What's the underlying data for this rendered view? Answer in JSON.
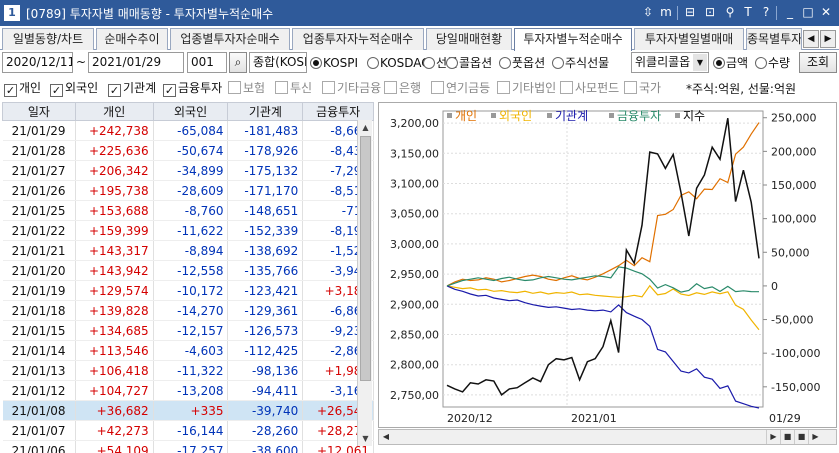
{
  "window": {
    "number": "1",
    "title": "[0789] 투자자별 매매동향 - 투자자별누적순매수",
    "icons": [
      "dock-icon",
      "memo-icon",
      "layout-icon",
      "link-icon",
      "pin-icon",
      "font-size-icon",
      "help-icon",
      "minimize-icon",
      "maximize-icon",
      "close-icon"
    ],
    "icon_glyphs": [
      "⇳",
      "m",
      "⊟",
      "⊡",
      "⚲",
      "T",
      "?",
      "_",
      "□",
      "✕"
    ],
    "title_bg": "#2f5a9a"
  },
  "tabs": [
    {
      "label": "일별동향/차트",
      "active": false
    },
    {
      "label": "순매수추이",
      "active": false
    },
    {
      "label": "업종별투자자순매수",
      "active": false
    },
    {
      "label": "업종투자자누적순매수",
      "active": false
    },
    {
      "label": "당일매매현황",
      "active": false
    },
    {
      "label": "투자자별누적순매수",
      "active": true
    },
    {
      "label": "투자자별일별매매",
      "active": false
    },
    {
      "label": "종목별투자",
      "active": false
    }
  ],
  "controls": {
    "start_date": "2020/12/11",
    "range_sep": "~",
    "end_date": "2021/01/29",
    "code": "001",
    "search_icon": "search-icon",
    "index_name": "종합(KOSP",
    "markets": [
      {
        "label": "KOSPI",
        "selected": true
      },
      {
        "label": "KOSDAQ",
        "selected": false
      },
      {
        "label": "선물",
        "selected": false
      },
      {
        "label": "콜옵션",
        "selected": false
      },
      {
        "label": "풋옵션",
        "selected": false
      },
      {
        "label": "주식선물",
        "selected": false
      }
    ],
    "weekly_select": "위클리콜옵",
    "value_modes": [
      {
        "label": "금액",
        "selected": true
      },
      {
        "label": "수량",
        "selected": false
      }
    ],
    "query_button": "조회"
  },
  "investor_filters": [
    {
      "label": "개인",
      "checked": true
    },
    {
      "label": "외국인",
      "checked": true
    },
    {
      "label": "기관계",
      "checked": true
    },
    {
      "label": "금융투자",
      "checked": true
    },
    {
      "label": "보험",
      "checked": false
    },
    {
      "label": "투신",
      "checked": false
    },
    {
      "label": "기타금융",
      "checked": false
    },
    {
      "label": "은행",
      "checked": false
    },
    {
      "label": "연기금등",
      "checked": false
    },
    {
      "label": "기타법인",
      "checked": false
    },
    {
      "label": "사모펀드",
      "checked": false
    },
    {
      "label": "국가",
      "checked": false
    }
  ],
  "unit_note": "*주식:억원, 선물:억원",
  "table": {
    "headers": [
      "일자",
      "개인",
      "외국인",
      "기관계",
      "금융투자"
    ],
    "selected_row": 14,
    "rows": [
      [
        "21/01/29",
        "+242,738",
        "-65,084",
        "-181,483",
        "-8,661"
      ],
      [
        "21/01/28",
        "+225,636",
        "-50,674",
        "-178,926",
        "-8,436"
      ],
      [
        "21/01/27",
        "+206,342",
        "-34,899",
        "-175,132",
        "-7,297"
      ],
      [
        "21/01/26",
        "+195,738",
        "-28,609",
        "-171,170",
        "-8,518"
      ],
      [
        "21/01/25",
        "+153,688",
        "-8,760",
        "-148,651",
        "-715"
      ],
      [
        "21/01/22",
        "+159,399",
        "-11,622",
        "-152,339",
        "-8,195"
      ],
      [
        "21/01/21",
        "+143,317",
        "-8,894",
        "-138,692",
        "-1,521"
      ],
      [
        "21/01/20",
        "+143,942",
        "-12,558",
        "-135,766",
        "-3,946"
      ],
      [
        "21/01/19",
        "+129,574",
        "-10,172",
        "-123,421",
        "+3,187"
      ],
      [
        "21/01/18",
        "+139,828",
        "-14,270",
        "-129,361",
        "-6,869"
      ],
      [
        "21/01/15",
        "+134,685",
        "-12,157",
        "-126,573",
        "-9,236"
      ],
      [
        "21/01/14",
        "+113,546",
        "-4,603",
        "-112,425",
        "-2,867"
      ],
      [
        "21/01/13",
        "+106,418",
        "-11,322",
        "-98,136",
        "+1,980"
      ],
      [
        "21/01/12",
        "+104,727",
        "-13,208",
        "-94,411",
        "-3,161"
      ],
      [
        "21/01/08",
        "+36,682",
        "+335",
        "-39,740",
        "+26,540"
      ],
      [
        "21/01/07",
        "+42,273",
        "-16,144",
        "-28,260",
        "+28,272"
      ],
      [
        "21/01/06",
        "+54,109",
        "-17,257",
        "-38,600",
        "+12,061"
      ]
    ]
  },
  "colors": {
    "positive": "#d40000",
    "negative": "#0033b8",
    "series_individual": "#e07000",
    "series_foreign": "#f0b400",
    "series_institution": "#1a1aaa",
    "series_financial": "#2a8a6a",
    "series_index": "#111111"
  },
  "scrollbar_buttons": [
    "◀",
    "▶",
    "■",
    "■",
    "▶"
  ],
  "chart_data": {
    "type": "line",
    "legend": [
      "개인",
      "외국인",
      "기관계",
      "금융투자",
      "지수"
    ],
    "legend_placement": "top",
    "x_labels": [
      "2020/12",
      "2021/01",
      "01/29"
    ],
    "y_left_ticks": [
      "3,200,00",
      "3,150,00",
      "3,100,00",
      "3,050,00",
      "3,000,00",
      "2,950,00",
      "2,900,00",
      "2,850,00",
      "2,800,00",
      "2,750,00"
    ],
    "y_left_range": [
      2730,
      3220
    ],
    "y_right_ticks": [
      "250,000",
      "200,000",
      "150,000",
      "100,000",
      "50,000",
      "0",
      "-50,000",
      "-100,000",
      "-150,000"
    ],
    "y_right_range": [
      -180000,
      260000
    ],
    "grid": true,
    "series": [
      {
        "name": "개인",
        "axis": "right",
        "values": [
          0,
          6000,
          10000,
          8000,
          9000,
          12000,
          10000,
          6000,
          8000,
          11000,
          14000,
          16000,
          14000,
          10000,
          8000,
          12000,
          15000,
          11000,
          9000,
          13000,
          18000,
          24000,
          30000,
          38000,
          30000,
          42000,
          36000,
          104727,
          106418,
          113546,
          134685,
          139828,
          129574,
          143942,
          143317,
          159399,
          153688,
          195738,
          206342,
          225636,
          242738
        ]
      },
      {
        "name": "외국인",
        "axis": "right",
        "values": [
          0,
          -2000,
          -4000,
          -3000,
          -6000,
          -5000,
          -8000,
          -7000,
          -9000,
          -10000,
          -8000,
          -11000,
          -9000,
          -12000,
          -10000,
          -11000,
          -9000,
          -13000,
          -12000,
          -14000,
          -15000,
          -16000,
          -17000,
          -16000,
          -14000,
          -16144,
          335,
          -13208,
          -11322,
          -4603,
          -12157,
          -14270,
          -10172,
          -12558,
          -8894,
          -11622,
          -8760,
          -28609,
          -34899,
          -50674,
          -65084
        ]
      },
      {
        "name": "기관계",
        "axis": "right",
        "values": [
          0,
          -5000,
          -8000,
          -12000,
          -15000,
          -14000,
          -18000,
          -20000,
          -22000,
          -21000,
          -25000,
          -28000,
          -30000,
          -32000,
          -31000,
          -33000,
          -35000,
          -34000,
          -36000,
          -37000,
          -36000,
          -38600,
          -28260,
          -39740,
          -45000,
          -50000,
          -60000,
          -94411,
          -98136,
          -112425,
          -126573,
          -129361,
          -123421,
          -135766,
          -138692,
          -152339,
          -148651,
          -171170,
          -175132,
          -178926,
          -181483
        ]
      },
      {
        "name": "금융투자",
        "axis": "right",
        "values": [
          0,
          4000,
          8000,
          10000,
          12000,
          10000,
          8000,
          11000,
          13000,
          10000,
          8000,
          9000,
          12000,
          14000,
          12000,
          10000,
          9000,
          11000,
          13000,
          15000,
          14000,
          12061,
          28272,
          26540,
          22000,
          18000,
          10000,
          -3161,
          1980,
          -2867,
          -9236,
          -6869,
          3187,
          -3946,
          -1521,
          -8195,
          -715,
          -8518,
          -7297,
          -8436,
          -8661
        ]
      },
      {
        "name": "지수",
        "axis": "left",
        "values": [
          2766,
          2760,
          2755,
          2770,
          2768,
          2775,
          2773,
          2750,
          2760,
          2762,
          2770,
          2778,
          2772,
          2800,
          2810,
          2808,
          2812,
          2775,
          2805,
          2810,
          2830,
          2873,
          2820,
          2990,
          2968,
          3031,
          3152,
          3149,
          3125,
          3148,
          3085,
          3013,
          3092,
          3114,
          3160,
          3140,
          3208,
          3070,
          3122,
          3069,
          2976
        ]
      }
    ]
  }
}
